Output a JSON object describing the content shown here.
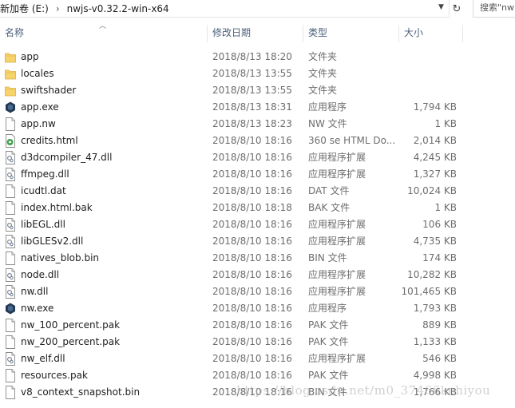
{
  "address_bar": {
    "segments": [
      "新加卷 (E:)",
      "nwjs-v0.32.2-win-x64"
    ],
    "search_placeholder": "搜索\"nw"
  },
  "columns": {
    "name": "名称",
    "date": "修改日期",
    "type": "类型",
    "size": "大小"
  },
  "files": [
    {
      "name": "app",
      "date": "2018/8/13 18:20",
      "type": "文件夹",
      "size": "",
      "icon": "folder-icon"
    },
    {
      "name": "locales",
      "date": "2018/8/13 13:55",
      "type": "文件夹",
      "size": "",
      "icon": "folder-icon"
    },
    {
      "name": "swiftshader",
      "date": "2018/8/13 13:55",
      "type": "文件夹",
      "size": "",
      "icon": "folder-icon"
    },
    {
      "name": "app.exe",
      "date": "2018/8/13 18:31",
      "type": "应用程序",
      "size": "1,794 KB",
      "icon": "nwjs-exe-icon"
    },
    {
      "name": "app.nw",
      "date": "2018/8/13 18:23",
      "type": "NW 文件",
      "size": "1 KB",
      "icon": "file-icon"
    },
    {
      "name": "credits.html",
      "date": "2018/8/10 18:16",
      "type": "360 se HTML Do...",
      "size": "2,014 KB",
      "icon": "html-file-icon"
    },
    {
      "name": "d3dcompiler_47.dll",
      "date": "2018/8/10 18:16",
      "type": "应用程序扩展",
      "size": "4,245 KB",
      "icon": "dll-file-icon"
    },
    {
      "name": "ffmpeg.dll",
      "date": "2018/8/10 18:16",
      "type": "应用程序扩展",
      "size": "1,327 KB",
      "icon": "dll-file-icon"
    },
    {
      "name": "icudtl.dat",
      "date": "2018/8/10 18:16",
      "type": "DAT 文件",
      "size": "10,024 KB",
      "icon": "file-icon"
    },
    {
      "name": "index.html.bak",
      "date": "2018/8/10 18:18",
      "type": "BAK 文件",
      "size": "1 KB",
      "icon": "file-icon"
    },
    {
      "name": "libEGL.dll",
      "date": "2018/8/10 18:16",
      "type": "应用程序扩展",
      "size": "106 KB",
      "icon": "dll-file-icon"
    },
    {
      "name": "libGLESv2.dll",
      "date": "2018/8/10 18:16",
      "type": "应用程序扩展",
      "size": "4,735 KB",
      "icon": "dll-file-icon"
    },
    {
      "name": "natives_blob.bin",
      "date": "2018/8/10 18:16",
      "type": "BIN 文件",
      "size": "174 KB",
      "icon": "file-icon"
    },
    {
      "name": "node.dll",
      "date": "2018/8/10 18:16",
      "type": "应用程序扩展",
      "size": "10,282 KB",
      "icon": "dll-file-icon"
    },
    {
      "name": "nw.dll",
      "date": "2018/8/10 18:16",
      "type": "应用程序扩展",
      "size": "101,465 KB",
      "icon": "dll-file-icon"
    },
    {
      "name": "nw.exe",
      "date": "2018/8/10 18:16",
      "type": "应用程序",
      "size": "1,793 KB",
      "icon": "nwjs-exe-icon"
    },
    {
      "name": "nw_100_percent.pak",
      "date": "2018/8/10 18:16",
      "type": "PAK 文件",
      "size": "889 KB",
      "icon": "file-icon"
    },
    {
      "name": "nw_200_percent.pak",
      "date": "2018/8/10 18:16",
      "type": "PAK 文件",
      "size": "1,133 KB",
      "icon": "file-icon"
    },
    {
      "name": "nw_elf.dll",
      "date": "2018/8/10 18:16",
      "type": "应用程序扩展",
      "size": "546 KB",
      "icon": "dll-file-icon"
    },
    {
      "name": "resources.pak",
      "date": "2018/8/10 18:16",
      "type": "PAK 文件",
      "size": "4,998 KB",
      "icon": "file-icon"
    },
    {
      "name": "v8_context_snapshot.bin",
      "date": "2018/8/10 18:16",
      "type": "BIN 文件",
      "size": "1,766 KB",
      "icon": "file-icon"
    }
  ],
  "watermark": "https://blog.csdn.net/m0_37466kchiyou",
  "colors": {
    "folder": "#f7d36b",
    "exe_badge": "#253b55",
    "header_text": "#4c607a",
    "secondary_text": "#6d6d6d"
  }
}
